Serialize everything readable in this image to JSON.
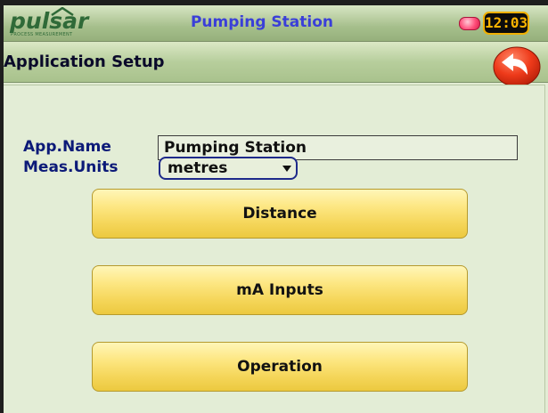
{
  "titlebar": {
    "logo_text": "pulsar",
    "logo_subtext": "PROCESS MEASUREMENT",
    "app_title": "Pumping Station",
    "clock": "12:03",
    "colors": {
      "title": "#3a3fd8",
      "logo": "#2f6a38",
      "clock": "#ffb400"
    }
  },
  "header": {
    "title": "Application Setup",
    "back_icon": "back-arrow-icon"
  },
  "form": {
    "app_name_label": "App.Name",
    "app_name_value": "Pumping Station",
    "units_label": "Meas.Units",
    "units_value": "metres"
  },
  "buttons": {
    "distance": "Distance",
    "ma_inputs": "mA Inputs",
    "operation": "Operation"
  }
}
